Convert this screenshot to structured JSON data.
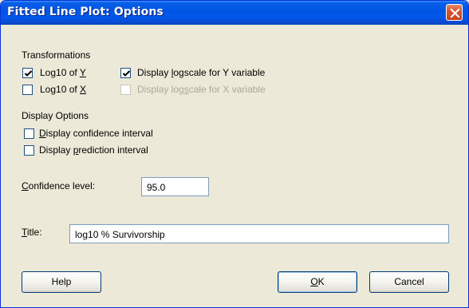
{
  "window": {
    "title": "Fitted Line Plot: Options",
    "close_icon": "close-icon"
  },
  "transformations": {
    "heading": "Transformations",
    "log10_y": {
      "pre": "Log10 of ",
      "key": "Y",
      "post": "",
      "checked": true
    },
    "log10_x": {
      "pre": "Log10 of ",
      "key": "X",
      "post": "",
      "checked": false
    },
    "logscale_y": {
      "pre": "Display ",
      "key": "l",
      "post": "ogscale for Y variable",
      "checked": true,
      "enabled": true
    },
    "logscale_x": {
      "pre": "Display log",
      "key": "s",
      "post": "cale for X variable",
      "checked": false,
      "enabled": false
    }
  },
  "display_options": {
    "heading": "Display Options",
    "confidence_interval": {
      "pre": "",
      "key": "D",
      "post": "isplay confidence interval",
      "checked": false
    },
    "prediction_interval": {
      "pre": "Display ",
      "key": "p",
      "post": "rediction interval",
      "checked": false
    }
  },
  "confidence_level": {
    "label_key": "C",
    "label_rest": "onfidence level:",
    "value": "95.0"
  },
  "title_field": {
    "label_key": "T",
    "label_rest": "itle:",
    "value": "log10 % Survivorship"
  },
  "buttons": {
    "help": "Help",
    "ok_key": "O",
    "ok_rest": "K",
    "cancel": "Cancel"
  }
}
